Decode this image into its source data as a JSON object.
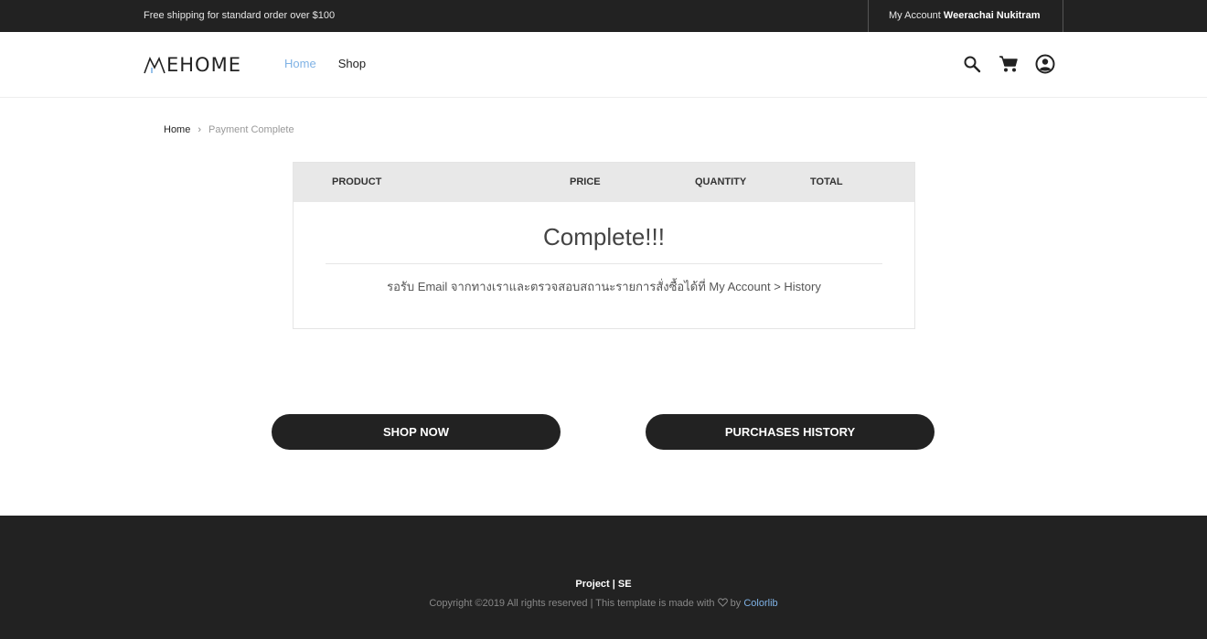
{
  "topbar": {
    "shipping_text": "Free shipping for standard order over $100",
    "account_label": "My Account",
    "account_name": "Weerachai Nukitram"
  },
  "header": {
    "logo_text": "EHOME",
    "nav": [
      {
        "label": "Home",
        "active": true
      },
      {
        "label": "Shop",
        "active": false
      }
    ],
    "icons": [
      "search-icon",
      "cart-icon",
      "user-account-icon"
    ]
  },
  "breadcrumb": {
    "home": "Home",
    "separator": "›",
    "current": "Payment Complete"
  },
  "cart": {
    "columns": {
      "product": "PRODUCT",
      "price": "PRICE",
      "quantity": "QUANTITY",
      "total": "TOTAL"
    },
    "complete_title": "Complete!!!",
    "complete_message": "รอรับ Email จากทางเราและตรวจสอบสถานะรายการสั่งซื้อได้ที่ My Account > History"
  },
  "buttons": {
    "shop_now": "SHOP NOW",
    "purchases_history": "PURCHASES HISTORY"
  },
  "footer": {
    "project": "Project | SE",
    "copyright_prefix": "Copyright ©2019 All rights reserved | This template is made with",
    "by": "by",
    "credit_link": "Colorlib"
  },
  "colors": {
    "dark": "#222222",
    "accent": "#7fb2e5",
    "table_header_bg": "#e8e8e8"
  }
}
